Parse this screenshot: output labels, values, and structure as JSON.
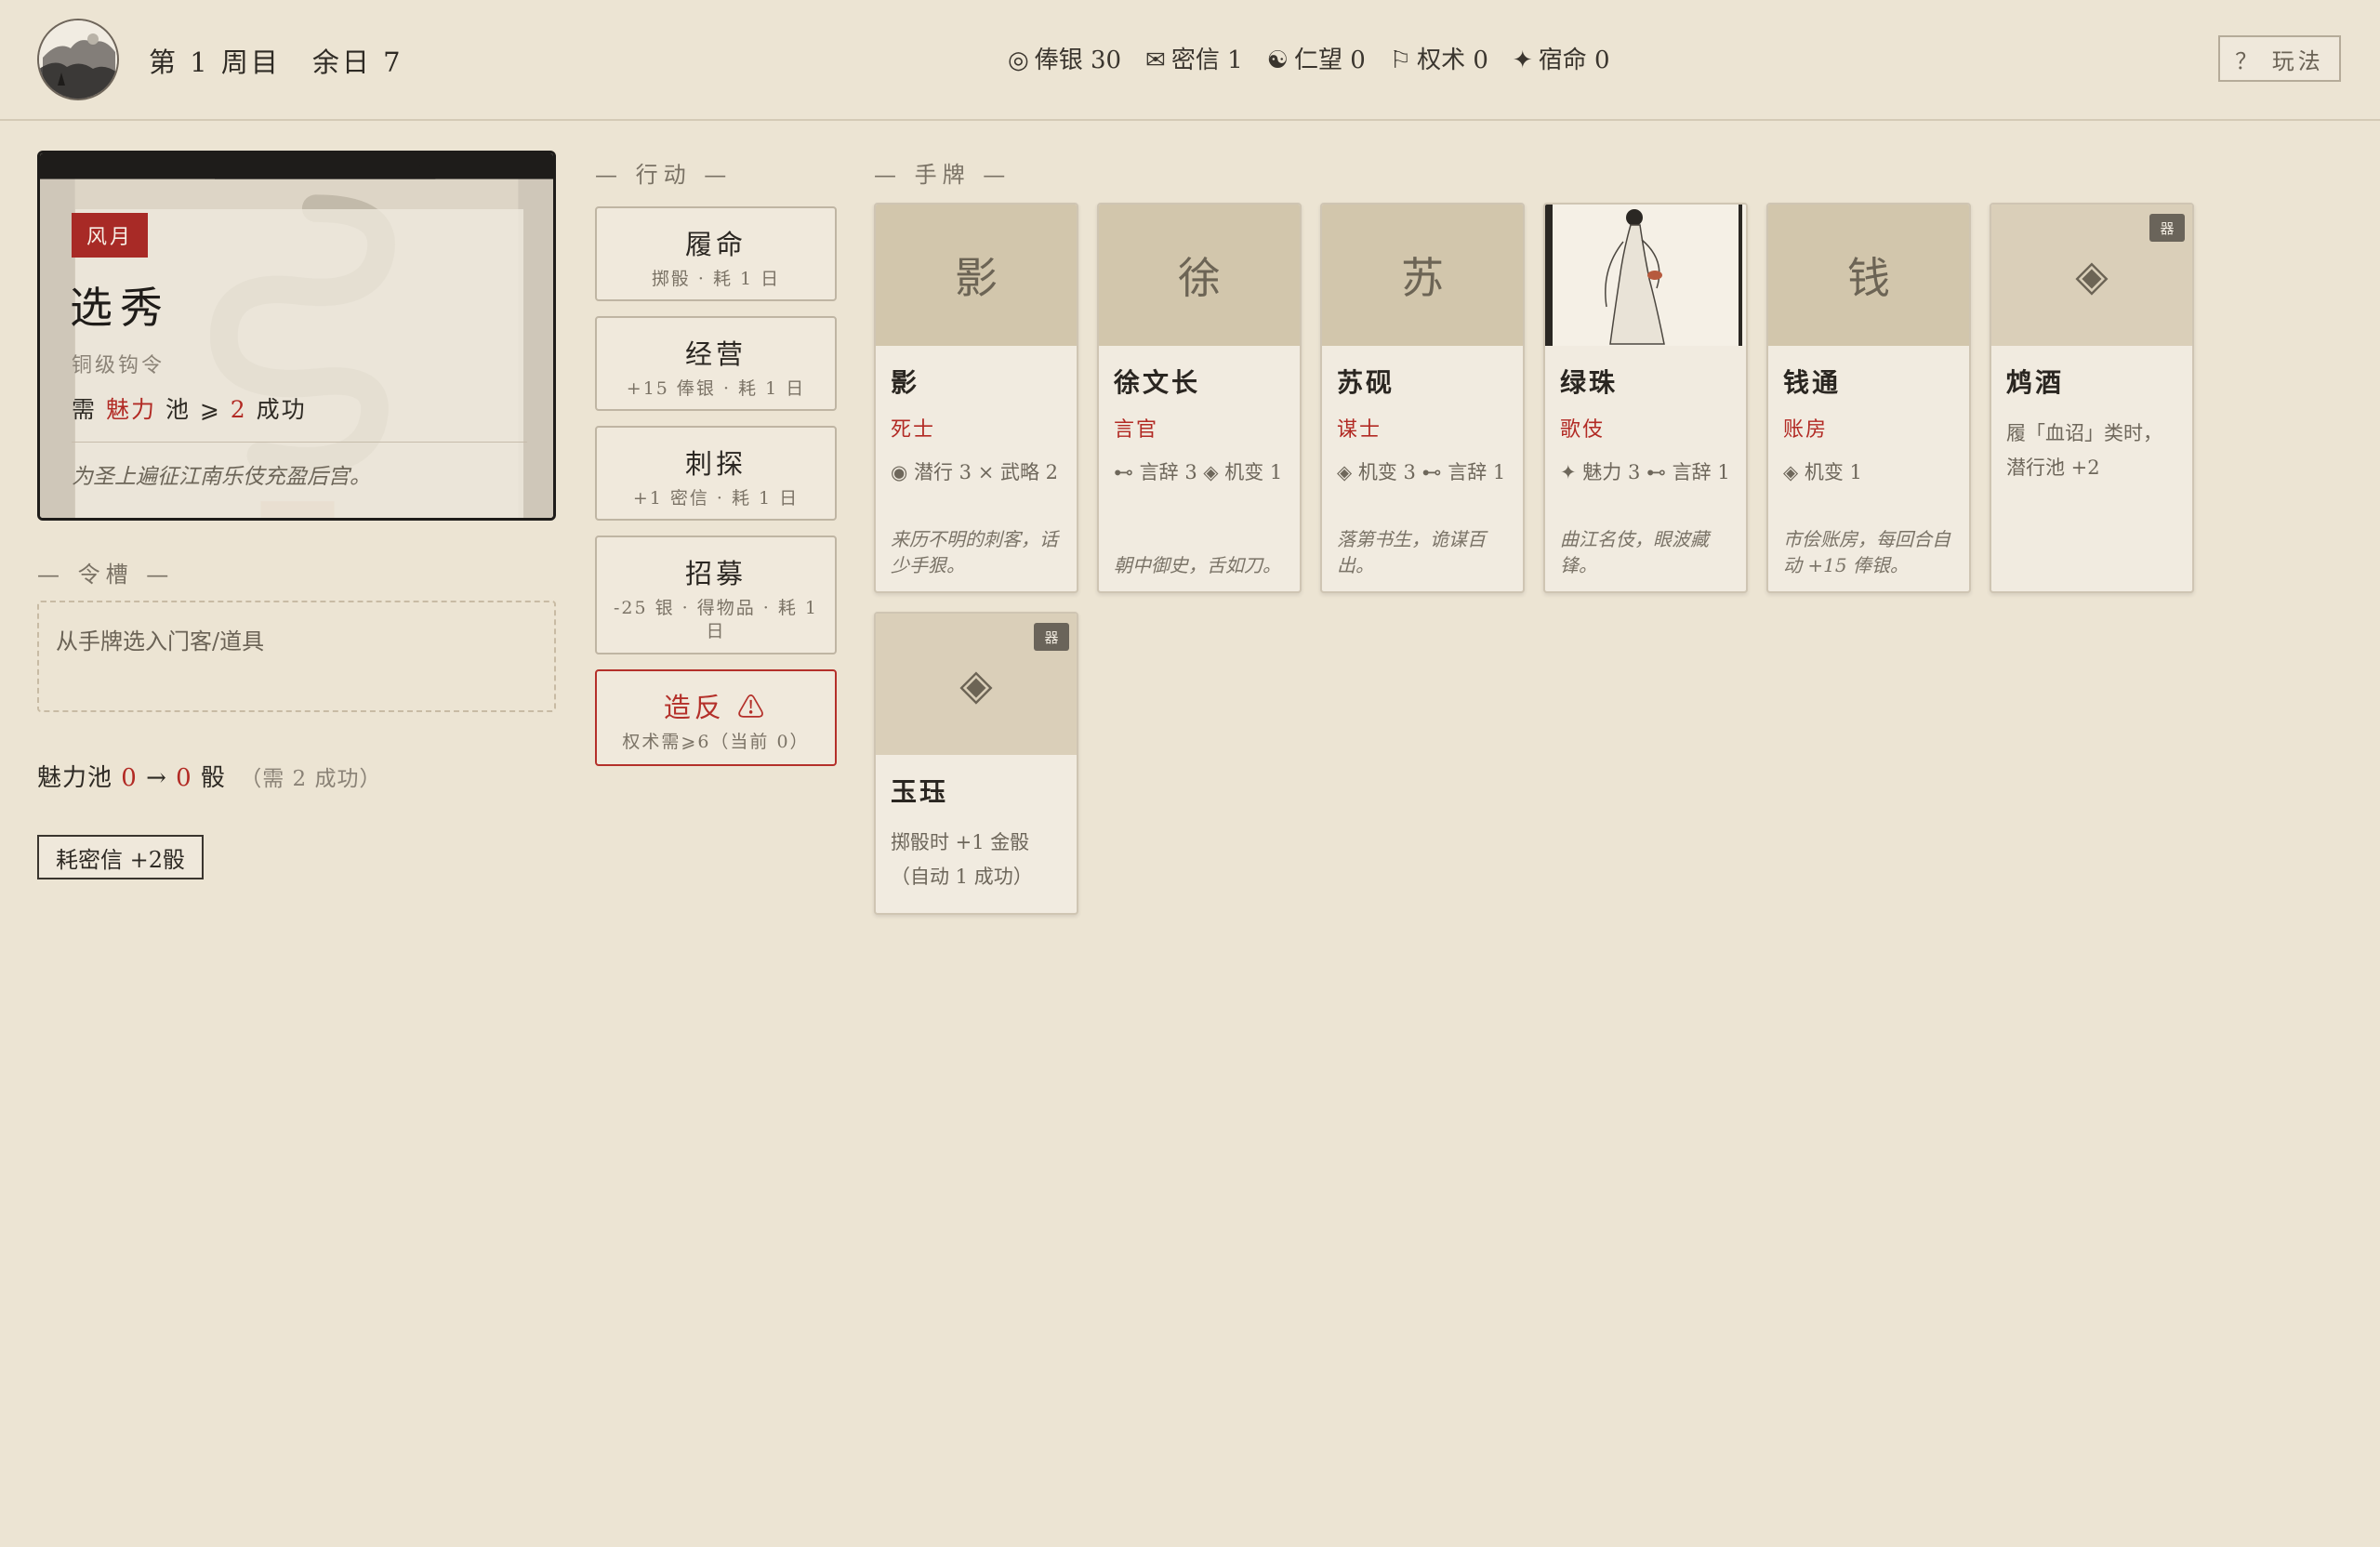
{
  "header": {
    "round": "第 1 周目",
    "days_left": "余日 7",
    "stats": [
      {
        "icon": "silver-icon",
        "glyph": "◎",
        "label": "俸银 30"
      },
      {
        "icon": "letter-icon",
        "glyph": "✉",
        "label": "密信 1"
      },
      {
        "icon": "yinyang-icon",
        "glyph": "☯",
        "label": "仁望 0"
      },
      {
        "icon": "flag-icon",
        "glyph": "⚐",
        "label": "权术 0"
      },
      {
        "icon": "star-icon",
        "glyph": "✦",
        "label": "宿命 0"
      }
    ],
    "help_button": "？ 玩法"
  },
  "event": {
    "tag": "风月",
    "title": "选秀",
    "subtitle": "铜级钩令",
    "req_prefix": "需",
    "req_attr": "魅力",
    "req_mid": "池 ⩾",
    "req_num": "2",
    "req_suffix": "成功",
    "description": "为圣上遍征江南乐伎充盈后宫。"
  },
  "slot": {
    "title": "— 令槽 —",
    "placeholder": "从手牌选入门客/道具"
  },
  "pool": {
    "label": "魅力池",
    "from": "0",
    "arrow": "→",
    "to": "0",
    "unit": "骰",
    "note": "（需 2 成功）"
  },
  "spend_button": "耗密信 +2骰",
  "actions_title": "— 行动 —",
  "actions": [
    {
      "name": "履命",
      "desc": "掷骰 · 耗 1 日"
    },
    {
      "name": "经营",
      "desc": "+15 俸银 · 耗 1 日"
    },
    {
      "name": "刺探",
      "desc": "+1 密信 · 耗 1 日"
    },
    {
      "name": "招募",
      "desc": "-25 银 · 得物品 · 耗 1 日"
    },
    {
      "name": "造反 ⚠",
      "desc": "权术需⩾6（当前 0）"
    }
  ],
  "hand_title": "— 手牌 —",
  "cards": [
    {
      "glyph": "影",
      "name": "影",
      "role": "死士",
      "stats": "◉ 潜行 3 ⨯ 武略 2",
      "flavor": "来历不明的刺客，话少手狠。"
    },
    {
      "glyph": "徐",
      "name": "徐文长",
      "role": "言官",
      "stats": "⊷ 言辞 3 ◈ 机变 1",
      "flavor": "朝中御史，舌如刀。"
    },
    {
      "glyph": "苏",
      "name": "苏砚",
      "role": "谋士",
      "stats": "◈ 机变 3 ⊷ 言辞 1",
      "flavor": "落第书生，诡谋百出。"
    },
    {
      "glyph": "",
      "name": "绿珠",
      "role": "歌伎",
      "stats": "✦ 魅力 3 ⊷ 言辞 1",
      "flavor": "曲江名伎，眼波藏锋。"
    },
    {
      "glyph": "钱",
      "name": "钱通",
      "role": "账房",
      "stats": "◈ 机变 1",
      "flavor": "市侩账房，每回合自动 +15 俸银。"
    },
    {
      "glyph": "◈",
      "badge": "器",
      "name": "鸩酒",
      "effect": "履「血诏」类时，潜行池 +2"
    },
    {
      "glyph": "◈",
      "badge": "器",
      "name": "玉珏",
      "effect": "掷骰时 +1 金骰（自动 1 成功）"
    }
  ],
  "colors": {
    "background": "#ece4d3",
    "accent_red": "#b22a24",
    "card_top": "#d2c6ac"
  }
}
